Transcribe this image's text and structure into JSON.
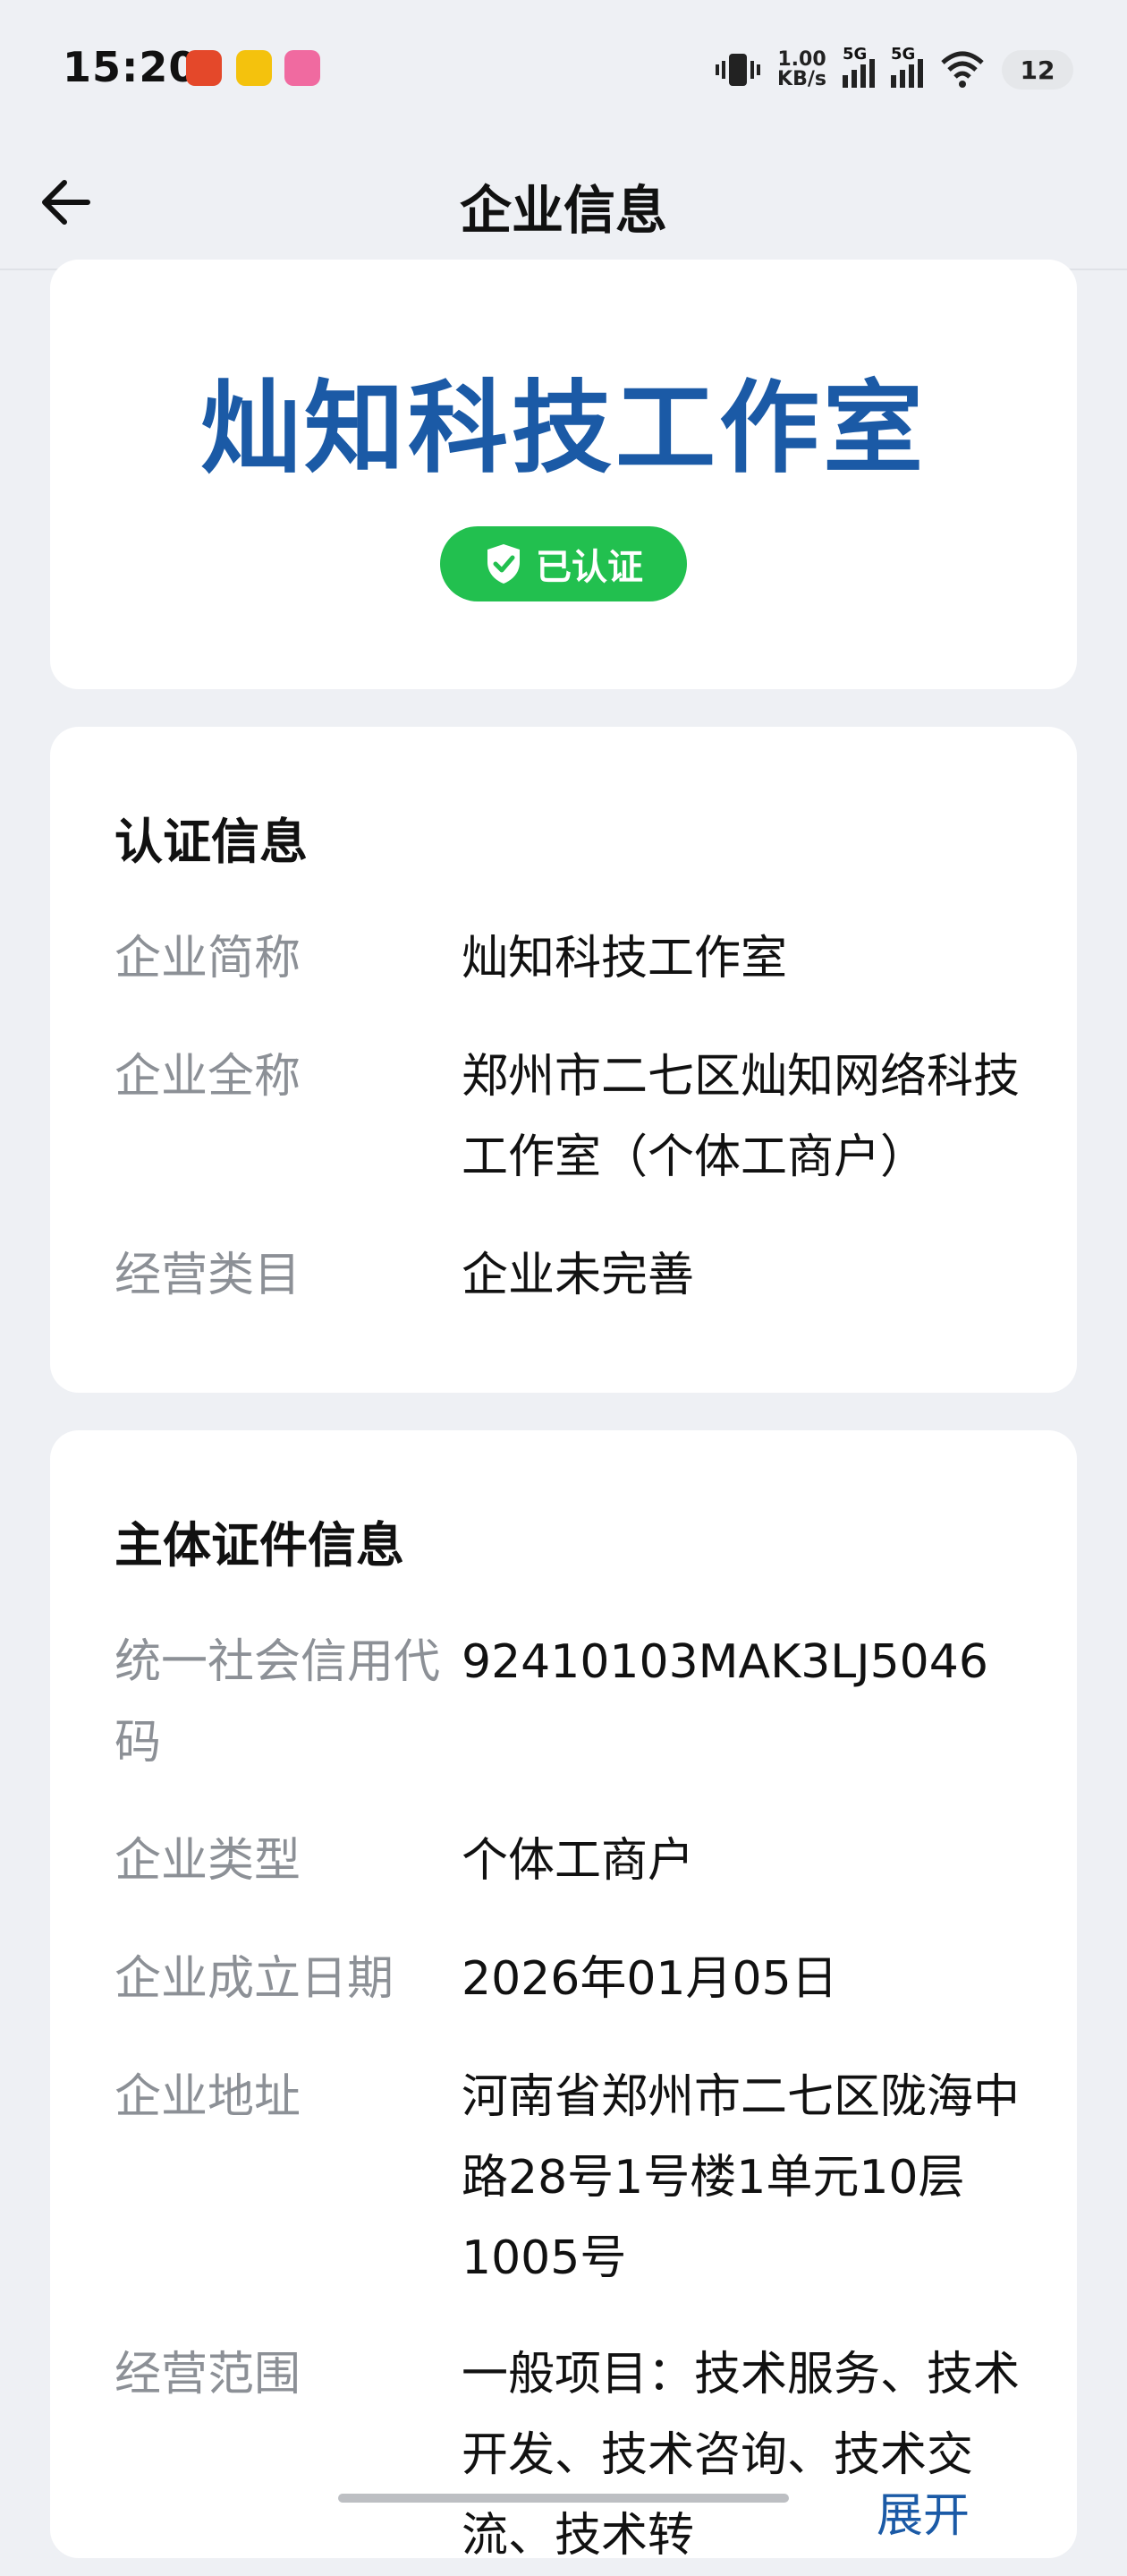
{
  "status_bar": {
    "time": "15:20",
    "net_speed_value": "1.00",
    "net_speed_unit": "KB/s",
    "signal1_label": "5G",
    "signal2_label": "5G",
    "battery": "12"
  },
  "header": {
    "title": "企业信息"
  },
  "company": {
    "name": "灿知科技工作室",
    "badge": "已认证"
  },
  "cert_info": {
    "title": "认证信息",
    "rows": [
      {
        "label": "企业简称",
        "value": "灿知科技工作室"
      },
      {
        "label": "企业全称",
        "value": "郑州市二七区灿知网络科技工作室（个体工商户）"
      },
      {
        "label": "经营类目",
        "value": "企业未完善"
      }
    ]
  },
  "subject_info": {
    "title": "主体证件信息",
    "rows": [
      {
        "label": "统一社会信用代码",
        "value": "92410103MAK3LJ5046"
      },
      {
        "label": "企业类型",
        "value": "个体工商户"
      },
      {
        "label": "企业成立日期",
        "value": "2026年01月05日"
      },
      {
        "label": "企业地址",
        "value": "河南省郑州市二七区陇海中路28号1号楼1单元10层1005号"
      },
      {
        "label": "经营范围",
        "value": "一般项目：技术服务、技术开发、技术咨询、技术交流、技术转"
      }
    ],
    "expand_label": "展开"
  },
  "colors": {
    "accent": "#1b5aa6",
    "verified": "#22c04f",
    "label": "#8c9096",
    "background": "#eef0f4"
  }
}
